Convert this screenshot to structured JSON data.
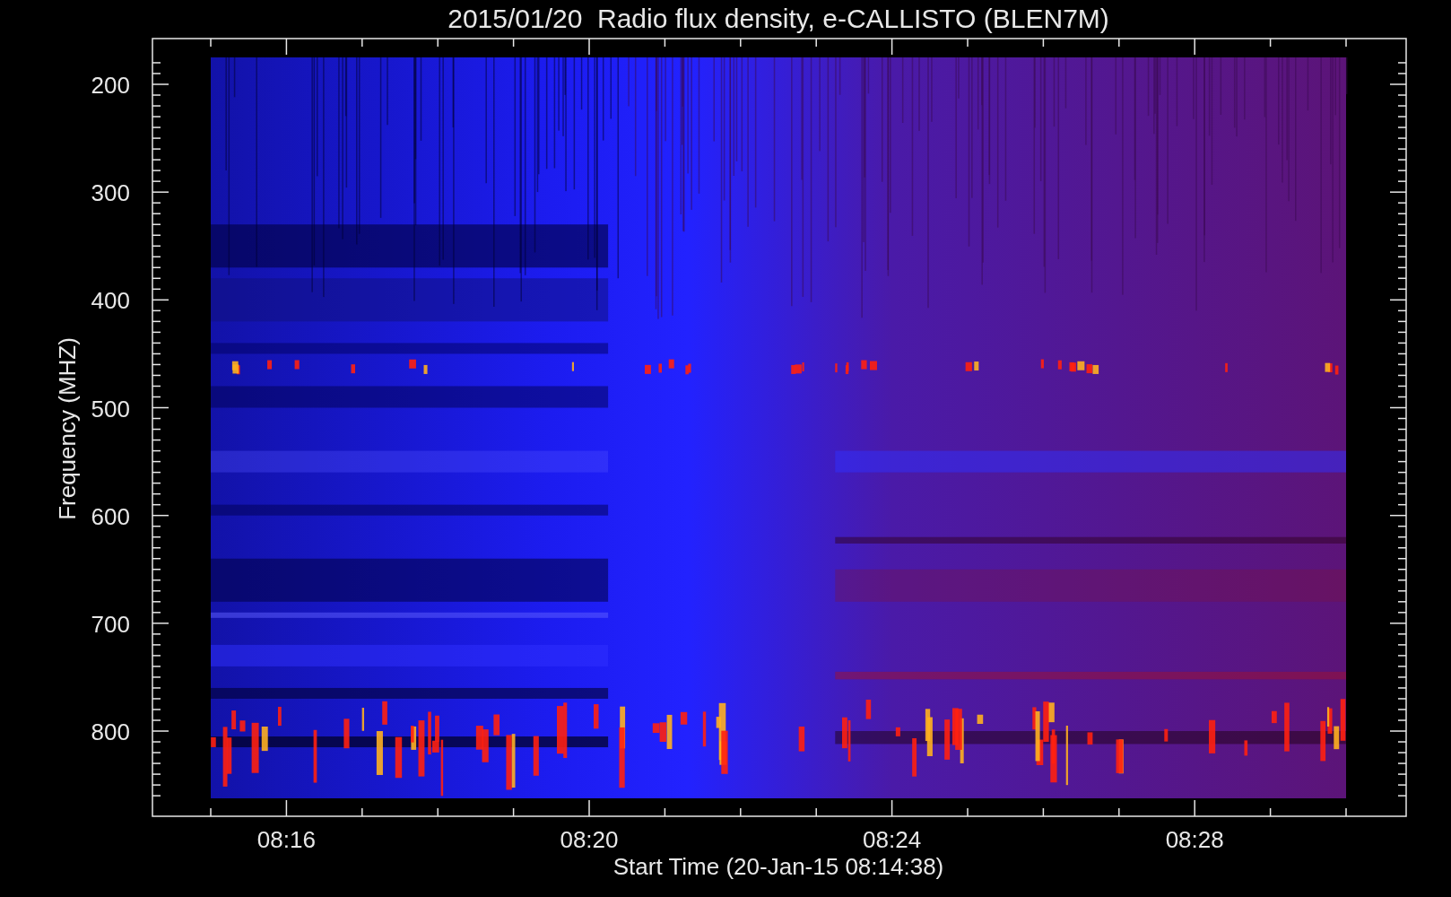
{
  "title": "2015/01/20  Radio flux density, e-CALLISTO (BLEN7M)",
  "y_axis": {
    "label": "Frequency (MHZ)",
    "ticks": [
      "200",
      "300",
      "400",
      "500",
      "600",
      "700",
      "800"
    ]
  },
  "x_axis": {
    "label": "Start Time (20-Jan-15 08:14:38)",
    "ticks": [
      "08:16",
      "08:20",
      "08:24",
      "08:28"
    ]
  }
}
